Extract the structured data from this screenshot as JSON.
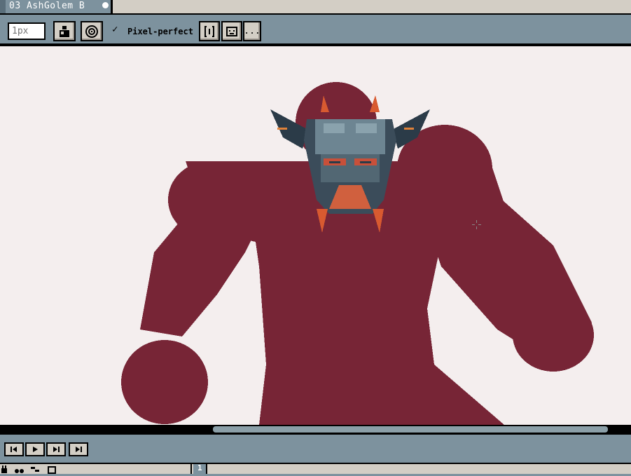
{
  "tab": {
    "title": "03 AshGolem B"
  },
  "toolbar": {
    "brush_size_placeholder": "1px",
    "pixel_perfect_check": "✓",
    "pixel_perfect_label": "Pixel-perfect",
    "more_label": "..."
  },
  "timeline": {
    "frame_number": "1"
  },
  "colors": {
    "figure": "#772536",
    "canvas": "#f4eeee",
    "chrome": "#7d929e",
    "button": "#d3cec5"
  }
}
